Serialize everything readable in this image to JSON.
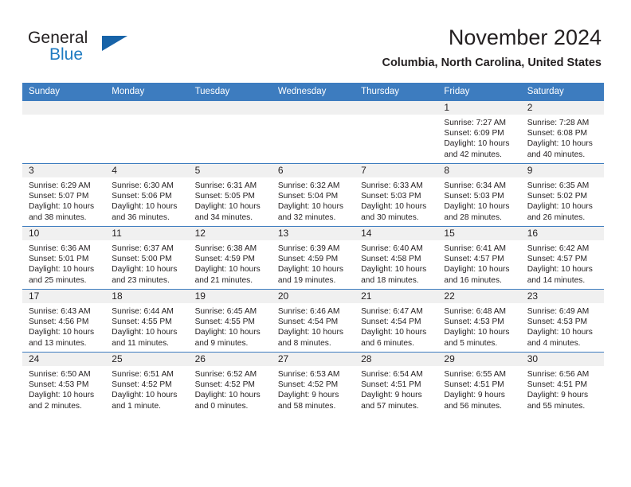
{
  "brand": {
    "name_part1": "General",
    "name_part2": "Blue",
    "logo_icon": "triangle-logo-icon"
  },
  "header": {
    "title": "November 2024",
    "subtitle": "Columbia, North Carolina, United States"
  },
  "calendar": {
    "weekday_headers": [
      "Sunday",
      "Monday",
      "Tuesday",
      "Wednesday",
      "Thursday",
      "Friday",
      "Saturday"
    ],
    "accent_color": "#3d7cbf",
    "daynum_band_color": "#f0f0f0",
    "weeks": [
      [
        {
          "day": "",
          "empty": true
        },
        {
          "day": "",
          "empty": true
        },
        {
          "day": "",
          "empty": true
        },
        {
          "day": "",
          "empty": true
        },
        {
          "day": "",
          "empty": true
        },
        {
          "day": "1",
          "sunrise": "Sunrise: 7:27 AM",
          "sunset": "Sunset: 6:09 PM",
          "daylight_line1": "Daylight: 10 hours",
          "daylight_line2": "and 42 minutes."
        },
        {
          "day": "2",
          "sunrise": "Sunrise: 7:28 AM",
          "sunset": "Sunset: 6:08 PM",
          "daylight_line1": "Daylight: 10 hours",
          "daylight_line2": "and 40 minutes."
        }
      ],
      [
        {
          "day": "3",
          "sunrise": "Sunrise: 6:29 AM",
          "sunset": "Sunset: 5:07 PM",
          "daylight_line1": "Daylight: 10 hours",
          "daylight_line2": "and 38 minutes."
        },
        {
          "day": "4",
          "sunrise": "Sunrise: 6:30 AM",
          "sunset": "Sunset: 5:06 PM",
          "daylight_line1": "Daylight: 10 hours",
          "daylight_line2": "and 36 minutes."
        },
        {
          "day": "5",
          "sunrise": "Sunrise: 6:31 AM",
          "sunset": "Sunset: 5:05 PM",
          "daylight_line1": "Daylight: 10 hours",
          "daylight_line2": "and 34 minutes."
        },
        {
          "day": "6",
          "sunrise": "Sunrise: 6:32 AM",
          "sunset": "Sunset: 5:04 PM",
          "daylight_line1": "Daylight: 10 hours",
          "daylight_line2": "and 32 minutes."
        },
        {
          "day": "7",
          "sunrise": "Sunrise: 6:33 AM",
          "sunset": "Sunset: 5:03 PM",
          "daylight_line1": "Daylight: 10 hours",
          "daylight_line2": "and 30 minutes."
        },
        {
          "day": "8",
          "sunrise": "Sunrise: 6:34 AM",
          "sunset": "Sunset: 5:03 PM",
          "daylight_line1": "Daylight: 10 hours",
          "daylight_line2": "and 28 minutes."
        },
        {
          "day": "9",
          "sunrise": "Sunrise: 6:35 AM",
          "sunset": "Sunset: 5:02 PM",
          "daylight_line1": "Daylight: 10 hours",
          "daylight_line2": "and 26 minutes."
        }
      ],
      [
        {
          "day": "10",
          "sunrise": "Sunrise: 6:36 AM",
          "sunset": "Sunset: 5:01 PM",
          "daylight_line1": "Daylight: 10 hours",
          "daylight_line2": "and 25 minutes."
        },
        {
          "day": "11",
          "sunrise": "Sunrise: 6:37 AM",
          "sunset": "Sunset: 5:00 PM",
          "daylight_line1": "Daylight: 10 hours",
          "daylight_line2": "and 23 minutes."
        },
        {
          "day": "12",
          "sunrise": "Sunrise: 6:38 AM",
          "sunset": "Sunset: 4:59 PM",
          "daylight_line1": "Daylight: 10 hours",
          "daylight_line2": "and 21 minutes."
        },
        {
          "day": "13",
          "sunrise": "Sunrise: 6:39 AM",
          "sunset": "Sunset: 4:59 PM",
          "daylight_line1": "Daylight: 10 hours",
          "daylight_line2": "and 19 minutes."
        },
        {
          "day": "14",
          "sunrise": "Sunrise: 6:40 AM",
          "sunset": "Sunset: 4:58 PM",
          "daylight_line1": "Daylight: 10 hours",
          "daylight_line2": "and 18 minutes."
        },
        {
          "day": "15",
          "sunrise": "Sunrise: 6:41 AM",
          "sunset": "Sunset: 4:57 PM",
          "daylight_line1": "Daylight: 10 hours",
          "daylight_line2": "and 16 minutes."
        },
        {
          "day": "16",
          "sunrise": "Sunrise: 6:42 AM",
          "sunset": "Sunset: 4:57 PM",
          "daylight_line1": "Daylight: 10 hours",
          "daylight_line2": "and 14 minutes."
        }
      ],
      [
        {
          "day": "17",
          "sunrise": "Sunrise: 6:43 AM",
          "sunset": "Sunset: 4:56 PM",
          "daylight_line1": "Daylight: 10 hours",
          "daylight_line2": "and 13 minutes."
        },
        {
          "day": "18",
          "sunrise": "Sunrise: 6:44 AM",
          "sunset": "Sunset: 4:55 PM",
          "daylight_line1": "Daylight: 10 hours",
          "daylight_line2": "and 11 minutes."
        },
        {
          "day": "19",
          "sunrise": "Sunrise: 6:45 AM",
          "sunset": "Sunset: 4:55 PM",
          "daylight_line1": "Daylight: 10 hours",
          "daylight_line2": "and 9 minutes."
        },
        {
          "day": "20",
          "sunrise": "Sunrise: 6:46 AM",
          "sunset": "Sunset: 4:54 PM",
          "daylight_line1": "Daylight: 10 hours",
          "daylight_line2": "and 8 minutes."
        },
        {
          "day": "21",
          "sunrise": "Sunrise: 6:47 AM",
          "sunset": "Sunset: 4:54 PM",
          "daylight_line1": "Daylight: 10 hours",
          "daylight_line2": "and 6 minutes."
        },
        {
          "day": "22",
          "sunrise": "Sunrise: 6:48 AM",
          "sunset": "Sunset: 4:53 PM",
          "daylight_line1": "Daylight: 10 hours",
          "daylight_line2": "and 5 minutes."
        },
        {
          "day": "23",
          "sunrise": "Sunrise: 6:49 AM",
          "sunset": "Sunset: 4:53 PM",
          "daylight_line1": "Daylight: 10 hours",
          "daylight_line2": "and 4 minutes."
        }
      ],
      [
        {
          "day": "24",
          "sunrise": "Sunrise: 6:50 AM",
          "sunset": "Sunset: 4:53 PM",
          "daylight_line1": "Daylight: 10 hours",
          "daylight_line2": "and 2 minutes."
        },
        {
          "day": "25",
          "sunrise": "Sunrise: 6:51 AM",
          "sunset": "Sunset: 4:52 PM",
          "daylight_line1": "Daylight: 10 hours",
          "daylight_line2": "and 1 minute."
        },
        {
          "day": "26",
          "sunrise": "Sunrise: 6:52 AM",
          "sunset": "Sunset: 4:52 PM",
          "daylight_line1": "Daylight: 10 hours",
          "daylight_line2": "and 0 minutes."
        },
        {
          "day": "27",
          "sunrise": "Sunrise: 6:53 AM",
          "sunset": "Sunset: 4:52 PM",
          "daylight_line1": "Daylight: 9 hours",
          "daylight_line2": "and 58 minutes."
        },
        {
          "day": "28",
          "sunrise": "Sunrise: 6:54 AM",
          "sunset": "Sunset: 4:51 PM",
          "daylight_line1": "Daylight: 9 hours",
          "daylight_line2": "and 57 minutes."
        },
        {
          "day": "29",
          "sunrise": "Sunrise: 6:55 AM",
          "sunset": "Sunset: 4:51 PM",
          "daylight_line1": "Daylight: 9 hours",
          "daylight_line2": "and 56 minutes."
        },
        {
          "day": "30",
          "sunrise": "Sunrise: 6:56 AM",
          "sunset": "Sunset: 4:51 PM",
          "daylight_line1": "Daylight: 9 hours",
          "daylight_line2": "and 55 minutes."
        }
      ]
    ]
  }
}
